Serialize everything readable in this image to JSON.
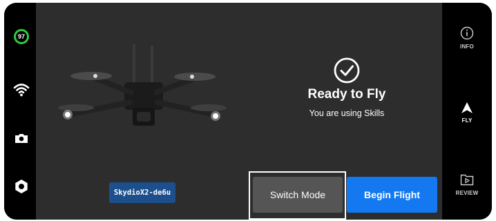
{
  "battery": {
    "level": "97",
    "color": "#2ecc40"
  },
  "left_rail": {
    "icons": [
      "wifi-icon",
      "camera-icon",
      "settings-gear-icon"
    ]
  },
  "right_rail": {
    "items": [
      {
        "label": "INFO",
        "icon": "info-icon"
      },
      {
        "label": "FLY",
        "icon": "fly-arrow-icon",
        "active": true
      },
      {
        "label": "REVIEW",
        "icon": "review-folder-icon"
      }
    ]
  },
  "status": {
    "title": "Ready to Fly",
    "subtitle": "You are using Skills",
    "icon": "check-circle-icon"
  },
  "drone": {
    "name": "SkydioX2-de6u",
    "badge_color": "#1c4f8c"
  },
  "buttons": {
    "switch_mode": "Switch Mode",
    "begin_flight": "Begin Flight",
    "begin_flight_color": "#1479f0"
  }
}
